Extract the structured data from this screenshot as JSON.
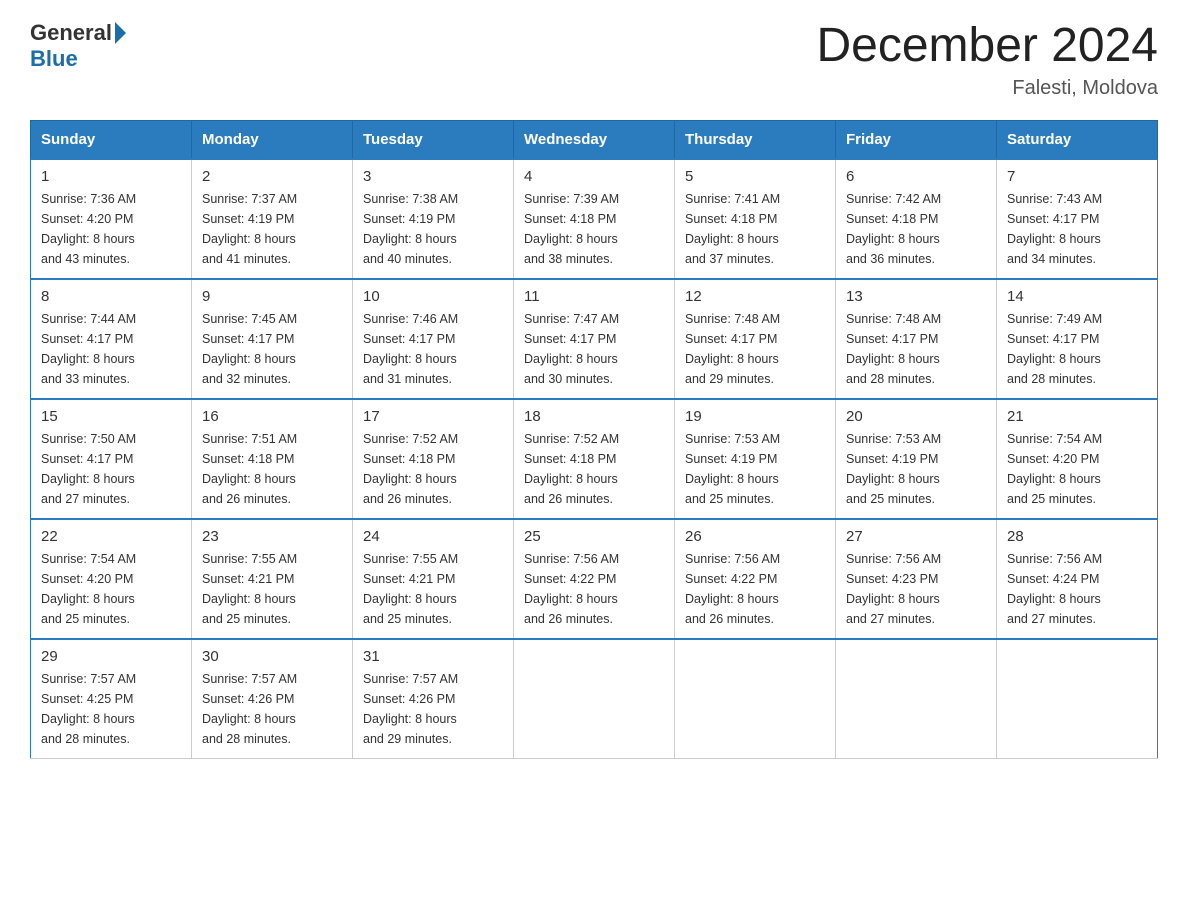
{
  "header": {
    "logo_general": "General",
    "logo_blue": "Blue",
    "title": "December 2024",
    "location": "Falesti, Moldova"
  },
  "days_header": [
    "Sunday",
    "Monday",
    "Tuesday",
    "Wednesday",
    "Thursday",
    "Friday",
    "Saturday"
  ],
  "weeks": [
    [
      {
        "day": "1",
        "sunrise": "7:36 AM",
        "sunset": "4:20 PM",
        "daylight": "8 hours and 43 minutes."
      },
      {
        "day": "2",
        "sunrise": "7:37 AM",
        "sunset": "4:19 PM",
        "daylight": "8 hours and 41 minutes."
      },
      {
        "day": "3",
        "sunrise": "7:38 AM",
        "sunset": "4:19 PM",
        "daylight": "8 hours and 40 minutes."
      },
      {
        "day": "4",
        "sunrise": "7:39 AM",
        "sunset": "4:18 PM",
        "daylight": "8 hours and 38 minutes."
      },
      {
        "day": "5",
        "sunrise": "7:41 AM",
        "sunset": "4:18 PM",
        "daylight": "8 hours and 37 minutes."
      },
      {
        "day": "6",
        "sunrise": "7:42 AM",
        "sunset": "4:18 PM",
        "daylight": "8 hours and 36 minutes."
      },
      {
        "day": "7",
        "sunrise": "7:43 AM",
        "sunset": "4:17 PM",
        "daylight": "8 hours and 34 minutes."
      }
    ],
    [
      {
        "day": "8",
        "sunrise": "7:44 AM",
        "sunset": "4:17 PM",
        "daylight": "8 hours and 33 minutes."
      },
      {
        "day": "9",
        "sunrise": "7:45 AM",
        "sunset": "4:17 PM",
        "daylight": "8 hours and 32 minutes."
      },
      {
        "day": "10",
        "sunrise": "7:46 AM",
        "sunset": "4:17 PM",
        "daylight": "8 hours and 31 minutes."
      },
      {
        "day": "11",
        "sunrise": "7:47 AM",
        "sunset": "4:17 PM",
        "daylight": "8 hours and 30 minutes."
      },
      {
        "day": "12",
        "sunrise": "7:48 AM",
        "sunset": "4:17 PM",
        "daylight": "8 hours and 29 minutes."
      },
      {
        "day": "13",
        "sunrise": "7:48 AM",
        "sunset": "4:17 PM",
        "daylight": "8 hours and 28 minutes."
      },
      {
        "day": "14",
        "sunrise": "7:49 AM",
        "sunset": "4:17 PM",
        "daylight": "8 hours and 28 minutes."
      }
    ],
    [
      {
        "day": "15",
        "sunrise": "7:50 AM",
        "sunset": "4:17 PM",
        "daylight": "8 hours and 27 minutes."
      },
      {
        "day": "16",
        "sunrise": "7:51 AM",
        "sunset": "4:18 PM",
        "daylight": "8 hours and 26 minutes."
      },
      {
        "day": "17",
        "sunrise": "7:52 AM",
        "sunset": "4:18 PM",
        "daylight": "8 hours and 26 minutes."
      },
      {
        "day": "18",
        "sunrise": "7:52 AM",
        "sunset": "4:18 PM",
        "daylight": "8 hours and 26 minutes."
      },
      {
        "day": "19",
        "sunrise": "7:53 AM",
        "sunset": "4:19 PM",
        "daylight": "8 hours and 25 minutes."
      },
      {
        "day": "20",
        "sunrise": "7:53 AM",
        "sunset": "4:19 PM",
        "daylight": "8 hours and 25 minutes."
      },
      {
        "day": "21",
        "sunrise": "7:54 AM",
        "sunset": "4:20 PM",
        "daylight": "8 hours and 25 minutes."
      }
    ],
    [
      {
        "day": "22",
        "sunrise": "7:54 AM",
        "sunset": "4:20 PM",
        "daylight": "8 hours and 25 minutes."
      },
      {
        "day": "23",
        "sunrise": "7:55 AM",
        "sunset": "4:21 PM",
        "daylight": "8 hours and 25 minutes."
      },
      {
        "day": "24",
        "sunrise": "7:55 AM",
        "sunset": "4:21 PM",
        "daylight": "8 hours and 25 minutes."
      },
      {
        "day": "25",
        "sunrise": "7:56 AM",
        "sunset": "4:22 PM",
        "daylight": "8 hours and 26 minutes."
      },
      {
        "day": "26",
        "sunrise": "7:56 AM",
        "sunset": "4:22 PM",
        "daylight": "8 hours and 26 minutes."
      },
      {
        "day": "27",
        "sunrise": "7:56 AM",
        "sunset": "4:23 PM",
        "daylight": "8 hours and 27 minutes."
      },
      {
        "day": "28",
        "sunrise": "7:56 AM",
        "sunset": "4:24 PM",
        "daylight": "8 hours and 27 minutes."
      }
    ],
    [
      {
        "day": "29",
        "sunrise": "7:57 AM",
        "sunset": "4:25 PM",
        "daylight": "8 hours and 28 minutes."
      },
      {
        "day": "30",
        "sunrise": "7:57 AM",
        "sunset": "4:26 PM",
        "daylight": "8 hours and 28 minutes."
      },
      {
        "day": "31",
        "sunrise": "7:57 AM",
        "sunset": "4:26 PM",
        "daylight": "8 hours and 29 minutes."
      },
      null,
      null,
      null,
      null
    ]
  ],
  "labels": {
    "sunrise": "Sunrise:",
    "sunset": "Sunset:",
    "daylight": "Daylight:"
  }
}
